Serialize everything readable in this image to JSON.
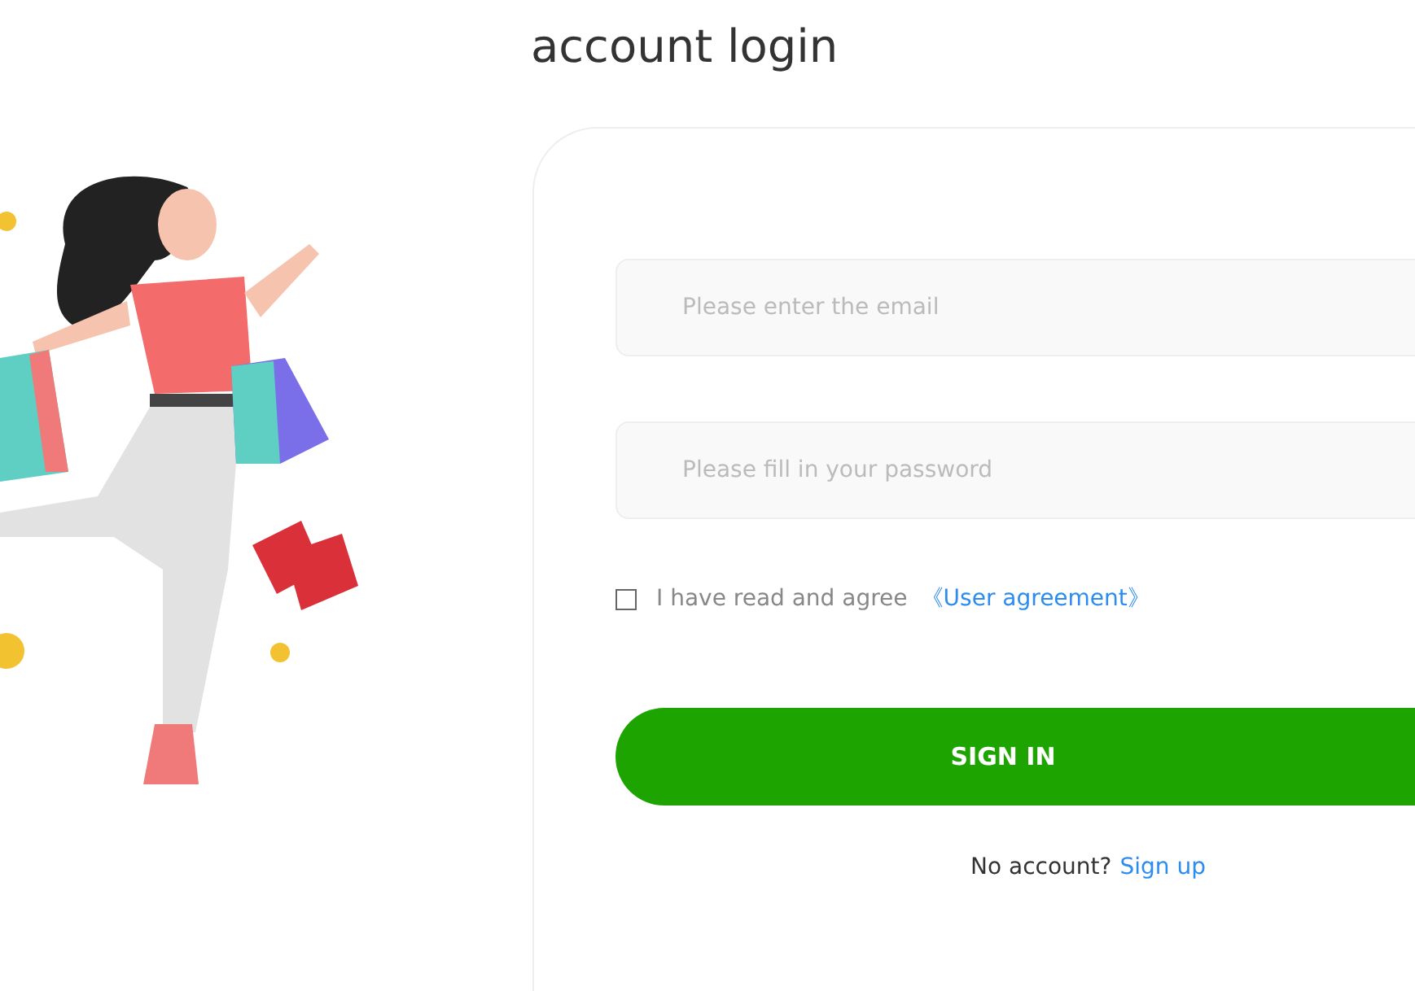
{
  "title": "account login",
  "form": {
    "email": {
      "placeholder": "Please enter the email"
    },
    "password": {
      "placeholder": "Please fill in your password"
    },
    "agreement": {
      "checked": false,
      "text": "I have read and agree",
      "link": "《User agreement》"
    },
    "submit": "SIGN IN",
    "signup": {
      "text": "No account?",
      "link": "Sign up"
    }
  }
}
